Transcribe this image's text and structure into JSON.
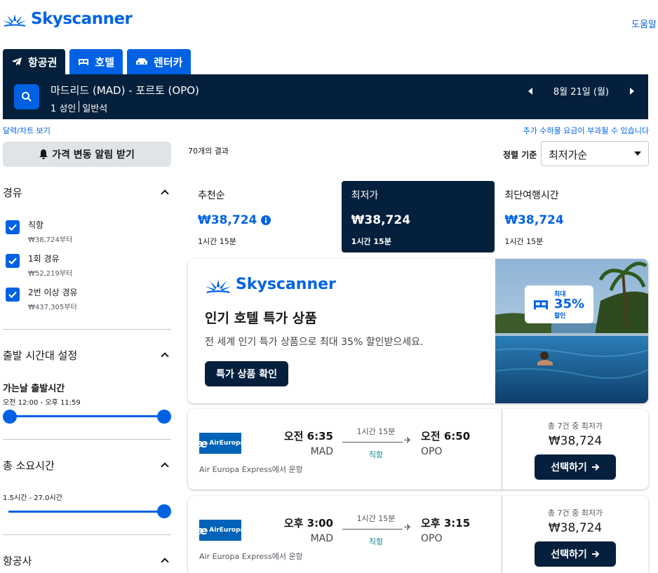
{
  "header": {
    "brand": "Skyscanner",
    "help": "도움말"
  },
  "tabs": [
    {
      "label": "항공권",
      "icon": "plane-icon"
    },
    {
      "label": "호텔",
      "icon": "bed-icon"
    },
    {
      "label": "렌터카",
      "icon": "car-icon"
    }
  ],
  "search": {
    "route": "마드리드 (MAD) - 포르토 (OPO)",
    "passengers": "1 성인",
    "cabin": "일반석",
    "date": "8월 21일 (월)"
  },
  "links": {
    "calendar": "달력/차트 보기",
    "fees": "추가 수하물 요금이 부과될 수 있습니다"
  },
  "sidebar": {
    "alert_button": "가격 변동 알림 받기",
    "stops": {
      "title": "경유",
      "options": [
        {
          "label": "직항",
          "price": "₩38,724부터",
          "checked": true
        },
        {
          "label": "1회 경유",
          "price": "₩52,219부터",
          "checked": true
        },
        {
          "label": "2번 이상 경유",
          "price": "₩437,305부터",
          "checked": true
        }
      ]
    },
    "departure": {
      "title": "출발 시간대 설정",
      "label": "가는날 출발시간",
      "range": "오전 12:00 - 오후 11:59"
    },
    "duration": {
      "title": "총 소요시간",
      "range": "1.5시간 - 27.0시간"
    },
    "airlines": {
      "title": "항공사"
    }
  },
  "results": {
    "count": "70개의 결과",
    "sort_label": "정렬 기준",
    "sort_value": "최저가순",
    "sort_tabs": [
      {
        "name": "추천순",
        "price": "₩38,724",
        "duration": "1시간 15분"
      },
      {
        "name": "최저가",
        "price": "₩38,724",
        "duration": "1시간 15분"
      },
      {
        "name": "최단여행시간",
        "price": "₩38,724",
        "duration": "1시간 15분"
      }
    ]
  },
  "ad": {
    "brand": "Skyscanner",
    "title": "인기 호텔 특가 상품",
    "description": "전 세계 인기 특가 상품으로 최대 35% 할인받으세요.",
    "button": "특가 상품 확인",
    "badge_top": "최대",
    "badge_value": "35%",
    "badge_bottom": "할인"
  },
  "flights": [
    {
      "airline": "AirEuropa",
      "operated_by": "Air Europa Express에서 운항",
      "dep_time": "오전 6:35",
      "dep_code": "MAD",
      "arr_time": "오전 6:50",
      "arr_code": "OPO",
      "duration": "1시간 15분",
      "stops": "직항",
      "deal_label": "총 7건 중 최저가",
      "price": "₩38,724",
      "button": "선택하기"
    },
    {
      "airline": "AirEuropa",
      "operated_by": "Air Europa Express에서 운항",
      "dep_time": "오후 3:00",
      "dep_code": "MAD",
      "arr_time": "오후 3:15",
      "arr_code": "OPO",
      "duration": "1시간 15분",
      "stops": "직항",
      "deal_label": "총 7건 중 최저가",
      "price": "₩38,724",
      "button": "선택하기"
    }
  ],
  "colors": {
    "brand": "#0062e3",
    "navy": "#05203c",
    "direct": "#0c838a"
  }
}
